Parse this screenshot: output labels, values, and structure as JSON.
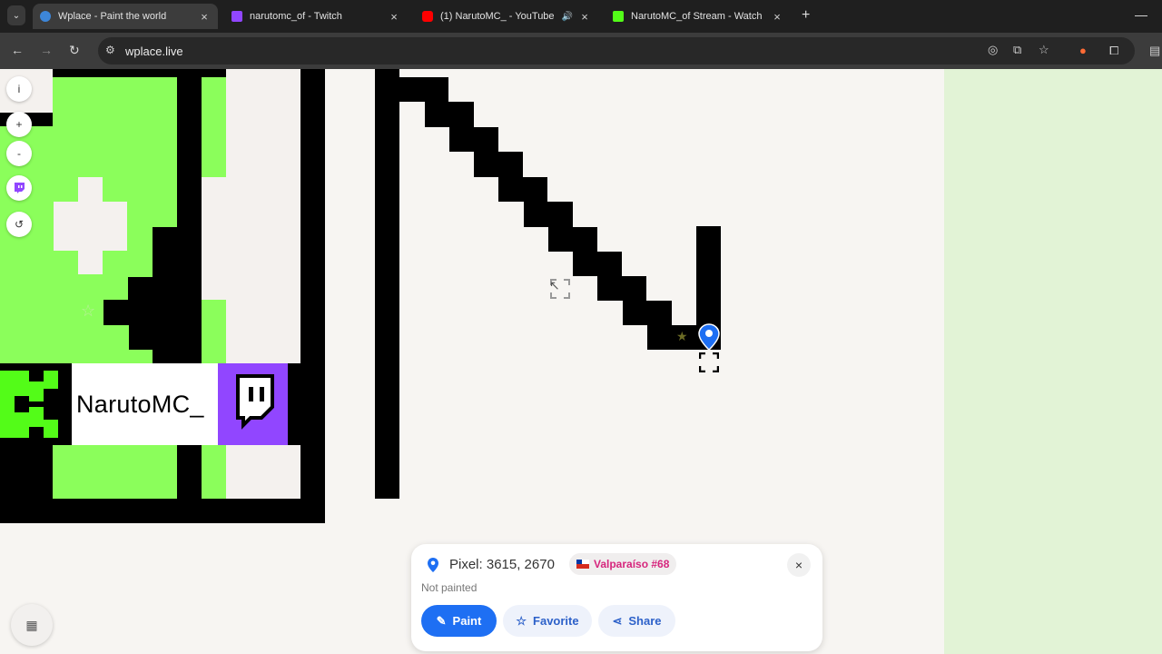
{
  "browser": {
    "tabs": [
      {
        "title": "Wplace - Paint the world",
        "favicon_color": "#3d86d8",
        "active": true
      },
      {
        "title": "narutomc_of - Twitch",
        "favicon_color": "#9146ff",
        "active": false
      },
      {
        "title": "(1) NarutoMC_ - YouTube",
        "favicon_color": "#ff0000",
        "active": false,
        "audio": true
      },
      {
        "title": "NarutoMC_of Stream - Watch L",
        "favicon_color": "#53fc18",
        "active": false
      }
    ],
    "new_tab_symbol": "+",
    "minimize_symbol": "—",
    "url": "wplace.live"
  },
  "canvas": {
    "banner_name": "NarutoMC_",
    "accent_green": "#8bfe5b",
    "twitch_purple": "#9146ff",
    "right_band": "#e2f3d6"
  },
  "controls": {
    "info": "i",
    "zoom_in": "+",
    "zoom_out": "-",
    "twitch": "t",
    "undo": "↺"
  },
  "panel": {
    "pixel_text": "Pixel: 3615, 2670",
    "region_label": "Valparaíso #68",
    "region_color": "#d6267d",
    "status": "Not painted",
    "paint_label": "Paint",
    "favorite_label": "Favorite",
    "share_label": "Share",
    "close_symbol": "×"
  }
}
